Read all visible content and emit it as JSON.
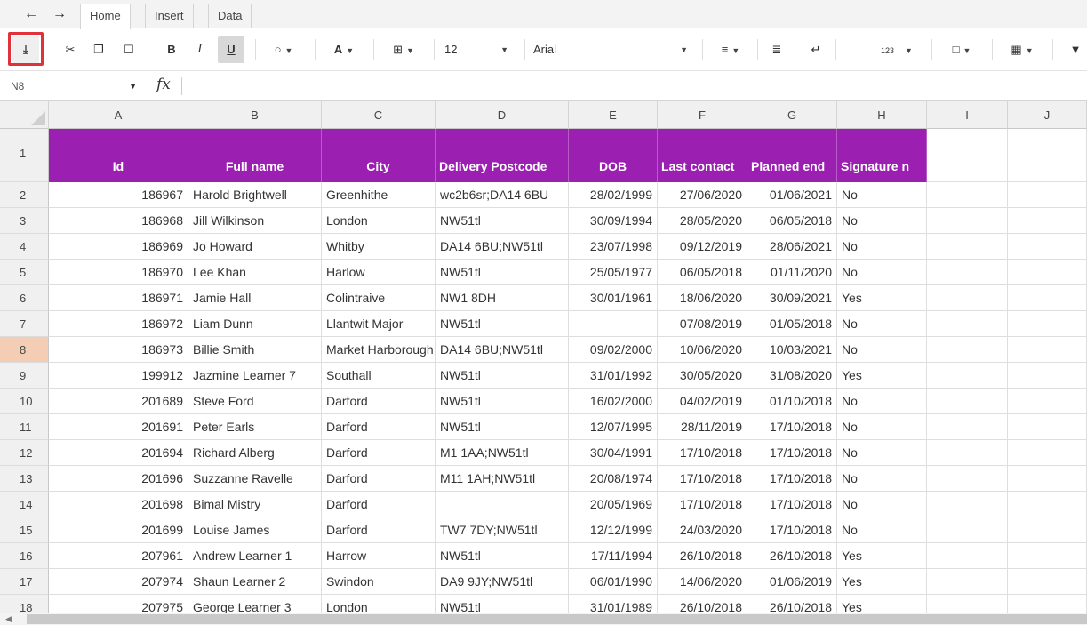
{
  "tabs": {
    "home": "Home",
    "insert": "Insert",
    "data": "Data"
  },
  "nav": {
    "back_icon": "undo-arrow",
    "forward_icon": "redo-arrow"
  },
  "toolbar": {
    "export_icon": "download-icon",
    "highlight_color": "#e0323b",
    "bold_label": "B",
    "italic_label": "I",
    "underline_label": "U",
    "font_size": "12",
    "font_name": "Arial",
    "number_format_label": "123"
  },
  "formula_bar": {
    "cell_ref": "N8",
    "fx_label": "fx",
    "value": ""
  },
  "columns": [
    "A",
    "B",
    "C",
    "D",
    "E",
    "F",
    "G",
    "H",
    "I",
    "J"
  ],
  "header_fill": "#9b1fb1",
  "header_row": {
    "row_number": "1",
    "cells": [
      "Id",
      "Full name",
      "City",
      "Delivery Postcode",
      "DOB",
      "Last contact",
      "Planned end",
      "Signature n"
    ]
  },
  "selected_row": "8",
  "rows": [
    {
      "n": "2",
      "cells": [
        "186967",
        "Harold Brightwell",
        "Greenhithe",
        "wc2b6sr;DA14 6BU",
        "28/02/1999",
        "27/06/2020",
        "01/06/2021",
        "No"
      ]
    },
    {
      "n": "3",
      "cells": [
        "186968",
        "Jill Wilkinson",
        "London",
        "NW51tl",
        "30/09/1994",
        "28/05/2020",
        "06/05/2018",
        "No"
      ]
    },
    {
      "n": "4",
      "cells": [
        "186969",
        "Jo Howard",
        "Whitby",
        "DA14 6BU;NW51tl",
        "23/07/1998",
        "09/12/2019",
        "28/06/2021",
        "No"
      ]
    },
    {
      "n": "5",
      "cells": [
        "186970",
        "Lee Khan",
        "Harlow",
        "NW51tl",
        "25/05/1977",
        "06/05/2018",
        "01/11/2020",
        "No"
      ]
    },
    {
      "n": "6",
      "cells": [
        "186971",
        "Jamie Hall",
        "Colintraive",
        "NW1 8DH",
        "30/01/1961",
        "18/06/2020",
        "30/09/2021",
        "Yes"
      ]
    },
    {
      "n": "7",
      "cells": [
        "186972",
        "Liam Dunn",
        "Llantwit Major",
        "NW51tl",
        "",
        "07/08/2019",
        "01/05/2018",
        "No"
      ]
    },
    {
      "n": "8",
      "cells": [
        "186973",
        "Billie Smith",
        "Market Harborough",
        "DA14 6BU;NW51tl",
        "09/02/2000",
        "10/06/2020",
        "10/03/2021",
        "No"
      ]
    },
    {
      "n": "9",
      "cells": [
        "199912",
        "Jazmine Learner 7",
        "Southall",
        "NW51tl",
        "31/01/1992",
        "30/05/2020",
        "31/08/2020",
        "Yes"
      ]
    },
    {
      "n": "10",
      "cells": [
        "201689",
        "Steve Ford",
        "Darford",
        "NW51tl",
        "16/02/2000",
        "04/02/2019",
        "01/10/2018",
        "No"
      ]
    },
    {
      "n": "11",
      "cells": [
        "201691",
        "Peter Earls",
        "Darford",
        "NW51tl",
        "12/07/1995",
        "28/11/2019",
        "17/10/2018",
        "No"
      ]
    },
    {
      "n": "12",
      "cells": [
        "201694",
        "Richard Alberg",
        "Darford",
        "M1 1AA;NW51tl",
        "30/04/1991",
        "17/10/2018",
        "17/10/2018",
        "No"
      ]
    },
    {
      "n": "13",
      "cells": [
        "201696",
        "Suzzanne Ravelle",
        "Darford",
        "M11 1AH;NW51tl",
        "20/08/1974",
        "17/10/2018",
        "17/10/2018",
        "No"
      ]
    },
    {
      "n": "14",
      "cells": [
        "201698",
        "Bimal Mistry",
        "Darford",
        "",
        "20/05/1969",
        "17/10/2018",
        "17/10/2018",
        "No"
      ]
    },
    {
      "n": "15",
      "cells": [
        "201699",
        "Louise James",
        "Darford",
        "TW7 7DY;NW51tl",
        "12/12/1999",
        "24/03/2020",
        "17/10/2018",
        "No"
      ]
    },
    {
      "n": "16",
      "cells": [
        "207961",
        "Andrew Learner 1",
        "Harrow",
        "NW51tl",
        "17/11/1994",
        "26/10/2018",
        "26/10/2018",
        "Yes"
      ]
    },
    {
      "n": "17",
      "cells": [
        "207974",
        "Shaun Learner 2",
        "Swindon",
        "DA9 9JY;NW51tl",
        "06/01/1990",
        "14/06/2020",
        "01/06/2019",
        "Yes"
      ]
    },
    {
      "n": "18",
      "cells": [
        "207975",
        "George Learner 3",
        "London",
        "NW51tl",
        "31/01/1989",
        "26/10/2018",
        "26/10/2018",
        "Yes"
      ]
    }
  ]
}
